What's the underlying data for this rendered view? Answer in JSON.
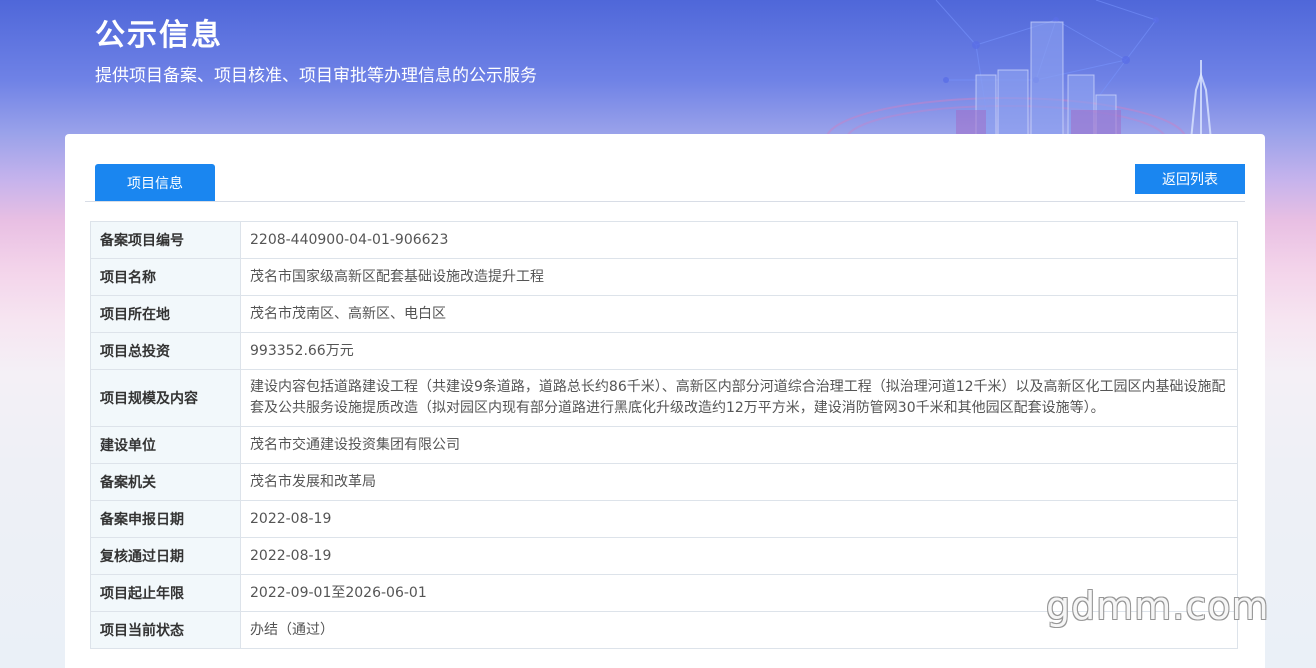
{
  "header": {
    "title": "公示信息",
    "subtitle": "提供项目备案、项目核准、项目审批等办理信息的公示服务"
  },
  "tabs": {
    "active_label": "项目信息"
  },
  "actions": {
    "back_label": "返回列表"
  },
  "rows": [
    {
      "label": "备案项目编号",
      "value": "2208-440900-04-01-906623"
    },
    {
      "label": "项目名称",
      "value": "茂名市国家级高新区配套基础设施改造提升工程"
    },
    {
      "label": "项目所在地",
      "value": "茂名市茂南区、高新区、电白区"
    },
    {
      "label": "项目总投资",
      "value": "993352.66万元"
    },
    {
      "label": "项目规模及内容",
      "value": "建设内容包括道路建设工程（共建设9条道路，道路总长约86千米）、高新区内部分河道综合治理工程（拟治理河道12千米）以及高新区化工园区内基础设施配套及公共服务设施提质改造（拟对园区内现有部分道路进行黑底化升级改造约12万平方米，建设消防管网30千米和其他园区配套设施等）。"
    },
    {
      "label": "建设单位",
      "value": "茂名市交通建设投资集团有限公司"
    },
    {
      "label": "备案机关",
      "value": "茂名市发展和改革局"
    },
    {
      "label": "备案申报日期",
      "value": "2022-08-19"
    },
    {
      "label": "复核通过日期",
      "value": "2022-08-19"
    },
    {
      "label": "项目起止年限",
      "value": "2022-09-01至2026-06-01"
    },
    {
      "label": "项目当前状态",
      "value": "办结（通过）"
    }
  ],
  "watermark": "gdmm.com"
}
